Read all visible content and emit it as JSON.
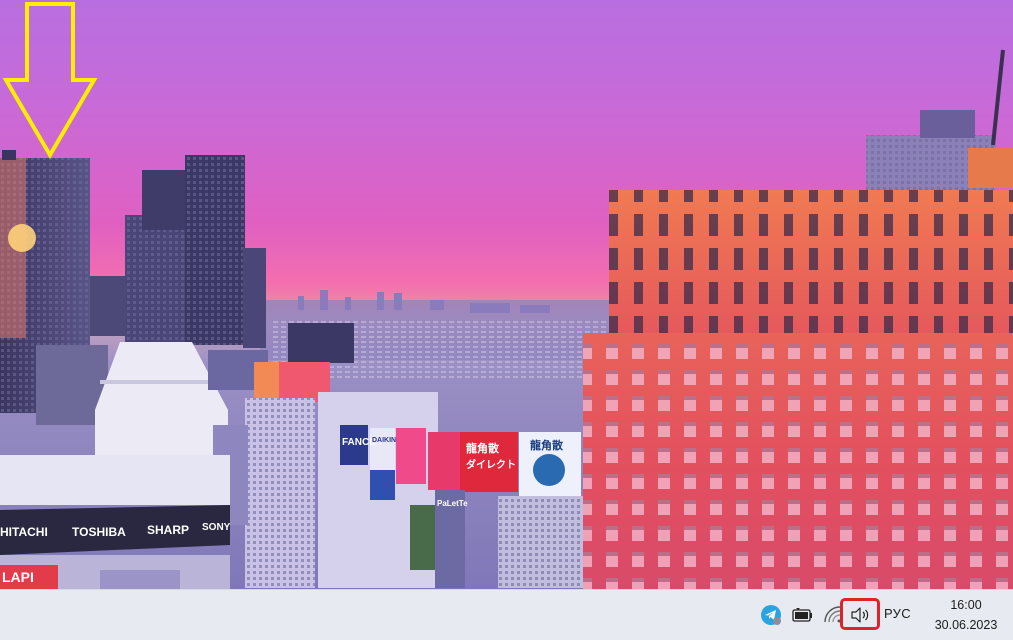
{
  "wallpaper": {
    "description_icon": "city-skyline-sunset-wallpaper",
    "signs": {
      "hitachi": "HITACHI",
      "toshiba": "TOSHIBA",
      "sharp": "SHARP",
      "sony": "SONY",
      "fancl": "FANCL",
      "daikin": "DAIKIN",
      "lapi": "LAPI",
      "palette": "PaLetTe",
      "ryukakusan_1": "龍角散",
      "ryukakusan_2": "ダイレクト",
      "ryukakusan_3": "龍角散"
    }
  },
  "annotation": {
    "arrow_color": "#ffee00",
    "highlight_color": "#e0232b"
  },
  "taskbar": {
    "tray": {
      "icons": [
        "telegram-icon",
        "battery-icon",
        "wifi-icon",
        "volume-icon"
      ],
      "language": "РУС",
      "time": "16:00",
      "date": "30.06.2023"
    }
  }
}
